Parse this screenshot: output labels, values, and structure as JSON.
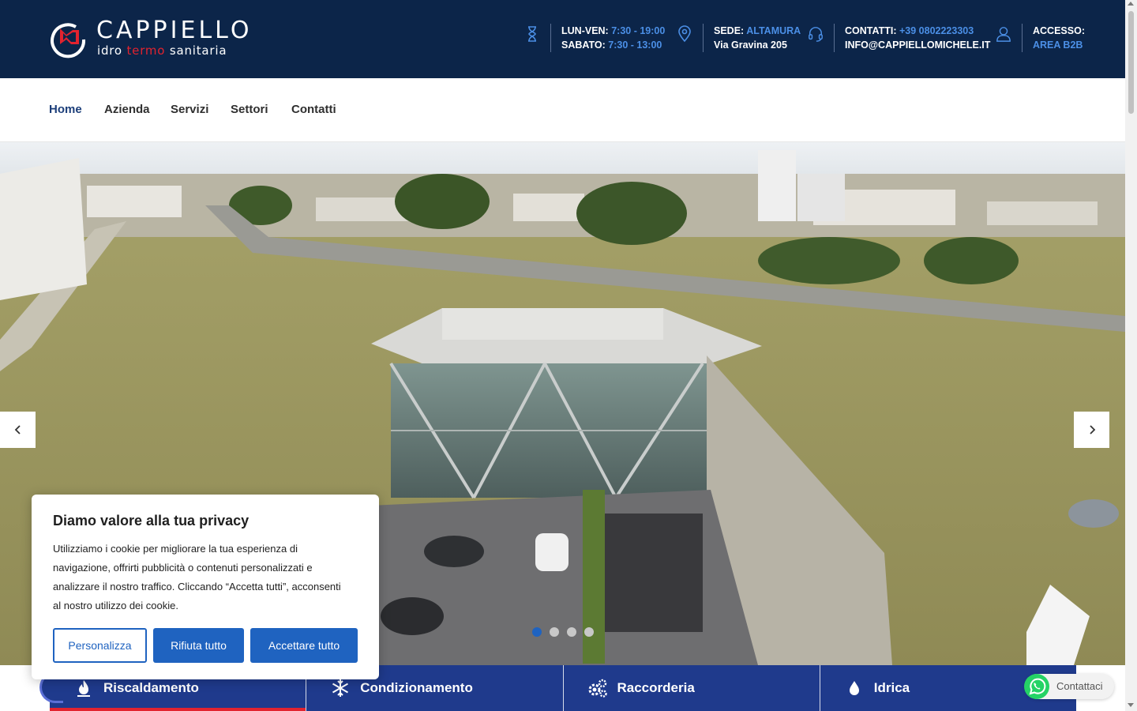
{
  "brand": {
    "name": "CAPPIELLO",
    "tagline_1": "idro",
    "tagline_2": "termo",
    "tagline_3": "sanitaria"
  },
  "header": {
    "hours": {
      "weekday_label": "LUN-VEN:",
      "weekday_value": "7:30 - 19:00",
      "saturday_label": "SABATO:",
      "saturday_value": "7:30 - 13:00"
    },
    "location": {
      "label": "SEDE:",
      "city": "ALTAMURA",
      "address": "Via Gravina 205"
    },
    "contacts": {
      "label": "CONTATTI:",
      "phone": "+39 0802223303",
      "email": "INFO@CAPPIELLOMICHELE.IT"
    },
    "access": {
      "label": "ACCESSO:",
      "link": "AREA B2B"
    }
  },
  "nav": {
    "items": [
      {
        "label": "Home"
      },
      {
        "label": "Azienda"
      },
      {
        "label": "Servizi"
      },
      {
        "label": "Settori"
      },
      {
        "label": "Contatti"
      }
    ]
  },
  "slider": {
    "slide_count": 4,
    "active_index": 0
  },
  "categories": [
    {
      "label": "Riscaldamento",
      "icon": "flame-icon"
    },
    {
      "label": "Condizionamento",
      "icon": "snowflake-icon"
    },
    {
      "label": "Raccorderia",
      "icon": "gears-icon"
    },
    {
      "label": "Idrica",
      "icon": "water-drop-icon"
    }
  ],
  "cookie": {
    "title": "Diamo valore alla tua privacy",
    "text": "Utilizziamo i cookie per migliorare la tua esperienza di navigazione, offrirti pubblicità o contenuti personalizzati e analizzare il nostro traffico. Cliccando “Accetta tutti”, acconsenti al nostro utilizzo dei cookie.",
    "customize_label": "Personalizza",
    "reject_label": "Rifiuta tutto",
    "accept_label": "Accettare tutto"
  },
  "whatsapp": {
    "label": "Contattaci"
  },
  "colors": {
    "header_bg": "#0c2549",
    "accent_blue": "#1f63c0",
    "category_bg": "#1f3a8c",
    "brand_red": "#e2232f"
  }
}
